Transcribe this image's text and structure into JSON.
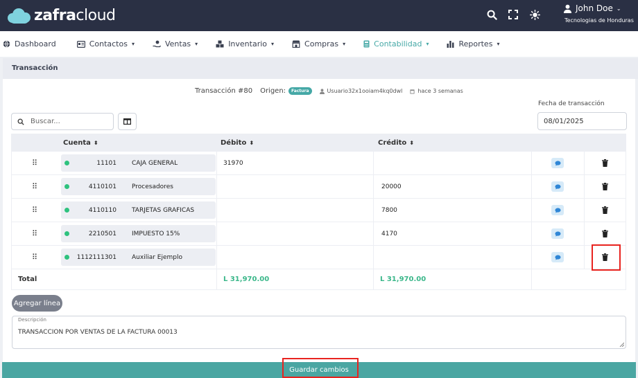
{
  "brand": {
    "name_bold": "zafra",
    "name_light": "cloud"
  },
  "user": {
    "name": "John Doe",
    "company": "Tecnologias de Honduras"
  },
  "nav": [
    {
      "label": "Dashboard",
      "icon": "globe-icon",
      "chevron": false
    },
    {
      "label": "Contactos",
      "icon": "id-card-icon",
      "chevron": true
    },
    {
      "label": "Ventas",
      "icon": "hand-coin-icon",
      "chevron": true
    },
    {
      "label": "Inventario",
      "icon": "boxes-icon",
      "chevron": true
    },
    {
      "label": "Compras",
      "icon": "store-icon",
      "chevron": true
    },
    {
      "label": "Contabilidad",
      "icon": "calculator-icon",
      "chevron": true,
      "active": true
    },
    {
      "label": "Reportes",
      "icon": "bar-chart-icon",
      "chevron": true
    }
  ],
  "section_title": "Transacción",
  "transaction": {
    "number": "Transacción #80",
    "origin_label": "Origen:",
    "origin_badge": "Factura",
    "user": "Usuario32x1ooiam4kq0dwl",
    "time": "hace 3 semanas"
  },
  "date": {
    "label": "Fecha de transacción",
    "value": "08/01/2025"
  },
  "search": {
    "placeholder": "Buscar..."
  },
  "table": {
    "headers": {
      "account": "Cuenta",
      "debit": "Débito",
      "credit": "Crédito"
    },
    "rows": [
      {
        "code": "11101",
        "name": "CAJA GENERAL",
        "debit": "31970",
        "credit": ""
      },
      {
        "code": "4110101",
        "name": "Procesadores",
        "debit": "",
        "credit": "20000"
      },
      {
        "code": "4110110",
        "name": "TARJETAS GRAFICAS",
        "debit": "",
        "credit": "7800"
      },
      {
        "code": "2210501",
        "name": "IMPUESTO 15%",
        "debit": "",
        "credit": "4170"
      },
      {
        "code": "1112111301",
        "name": "Auxiliar Ejemplo",
        "debit": "",
        "credit": ""
      }
    ],
    "total_label": "Total",
    "total_debit": "L 31,970.00",
    "total_credit": "L 31,970.00"
  },
  "add_line_label": "Agregar línea",
  "description": {
    "label": "Descripción",
    "value": "TRANSACCION POR VENTAS DE LA FACTURA  00013"
  },
  "save_label": "Guardar cambios",
  "colors": {
    "topbar": "#2a3044",
    "accent": "#45a8a6",
    "positive": "#3bb78a",
    "highlight": "#e8231f"
  }
}
